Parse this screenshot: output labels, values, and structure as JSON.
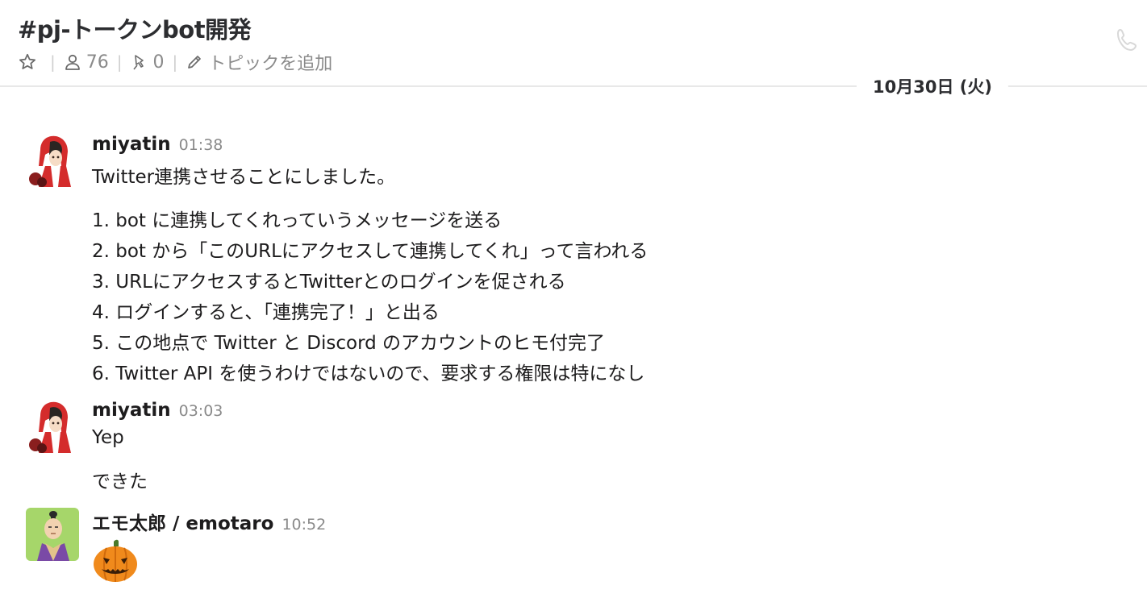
{
  "channel": {
    "title": "#pj-トークンbot開発",
    "members_count": "76",
    "pins_count": "0",
    "topic_label": "トピックを追加"
  },
  "icons": {
    "star": "star-icon",
    "member": "person-icon",
    "pin": "pin-icon",
    "pencil": "pencil-icon",
    "call": "phone-icon"
  },
  "date_divider": "10月30日 (火)",
  "messages": [
    {
      "author": "miyatin",
      "time": "01:38",
      "lines": [
        "Twitter連携させることにしました。",
        "1. bot に連携してくれっていうメッセージを送る",
        "2. bot から「このURLにアクセスして連携してくれ」って言われる",
        "3. URLにアクセスするとTwitterとのログインを促される",
        "4. ログインすると、「連携完了！」と出る",
        "5. この地点で Twitter と Discord のアカウントのヒモ付完了",
        "6. Twitter API を使うわけではないので、要求する権限は特になし"
      ]
    },
    {
      "author": "miyatin",
      "time": "03:03",
      "lines": [
        "Yep",
        "できた"
      ]
    },
    {
      "author": "エモ太郎 / emotaro",
      "time": "10:52",
      "emoji": "jack-o-lantern"
    }
  ],
  "colors": {
    "text": "#1d1c1d",
    "muted": "#8a8a8a",
    "divider": "#e8e8e8",
    "avatar_red": "#d42c2c",
    "avatar_green": "#a6d66a",
    "pumpkin": "#f08a1c"
  }
}
